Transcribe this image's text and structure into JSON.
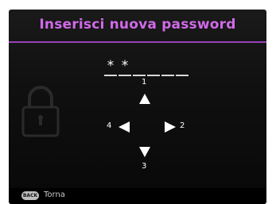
{
  "dialog": {
    "title": "Inserisci nuova password",
    "accent_color": "#d06ae8",
    "lock_icon": "padlock-icon"
  },
  "password": {
    "slots": [
      "*",
      "*",
      "",
      "",
      "",
      ""
    ]
  },
  "keypad": {
    "up": {
      "number": "1",
      "icon": "arrow-up-icon"
    },
    "right": {
      "number": "2",
      "icon": "arrow-right-icon"
    },
    "down": {
      "number": "3",
      "icon": "arrow-down-icon"
    },
    "left": {
      "number": "4",
      "icon": "arrow-left-icon"
    }
  },
  "footer": {
    "back_button": "BACK",
    "back_label": "Torna"
  }
}
